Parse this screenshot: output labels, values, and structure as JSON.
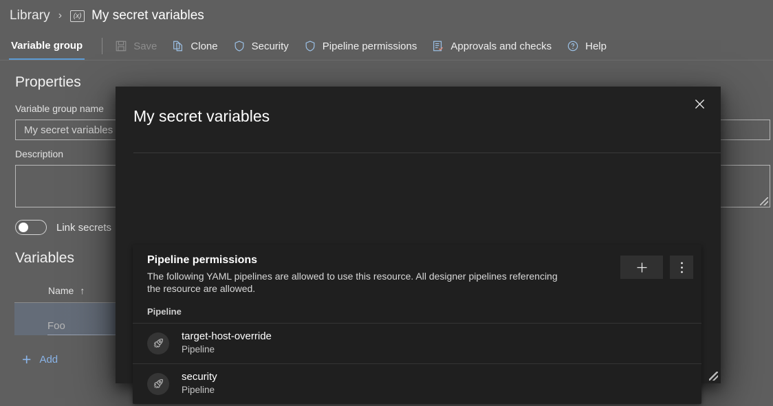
{
  "breadcrumb": {
    "root_label": "Library",
    "separator": "›",
    "icon": "variable-group-icon",
    "icon_glyph": "(x)",
    "current_label": "My secret variables"
  },
  "toolbar": {
    "tab_label": "Variable group",
    "accent_color": "#5b9bd5",
    "items": [
      {
        "label": "Save",
        "icon": "save-icon",
        "disabled": true
      },
      {
        "label": "Clone",
        "icon": "clone-icon",
        "disabled": false
      },
      {
        "label": "Security",
        "icon": "shield-icon",
        "disabled": false
      },
      {
        "label": "Pipeline permissions",
        "icon": "shield-icon",
        "disabled": false
      },
      {
        "label": "Approvals and checks",
        "icon": "checklist-icon",
        "disabled": false
      },
      {
        "label": "Help",
        "icon": "question-circle-icon",
        "disabled": false
      }
    ]
  },
  "properties": {
    "section_title": "Properties",
    "name_label": "Variable group name",
    "name_value": "My secret variables",
    "name_placeholder": "Variable group name",
    "description_label": "Description",
    "description_value": "",
    "description_placeholder": "",
    "link_secrets_label": "Link secrets",
    "link_secrets_on": false
  },
  "variables": {
    "section_title": "Variables",
    "columns": [
      "Name"
    ],
    "sort_indicator": "↑",
    "rows": [
      {
        "name": "Foo"
      }
    ],
    "add_label": "Add",
    "add_icon": "plus-icon"
  },
  "dialog": {
    "title": "My secret variables",
    "close_icon": "close-icon",
    "resize_icon": "resize-grip-icon",
    "card": {
      "title": "Pipeline permissions",
      "description": "The following YAML pipelines are allowed to use this resource. All designer pipelines referencing the resource are allowed.",
      "add_icon": "plus-icon",
      "more_icon": "more-vertical-icon",
      "column_header": "Pipeline",
      "rows": [
        {
          "name": "target-host-override",
          "subtitle": "Pipeline",
          "icon": "rocket-icon"
        },
        {
          "name": "security",
          "subtitle": "Pipeline",
          "icon": "rocket-icon"
        }
      ]
    }
  }
}
